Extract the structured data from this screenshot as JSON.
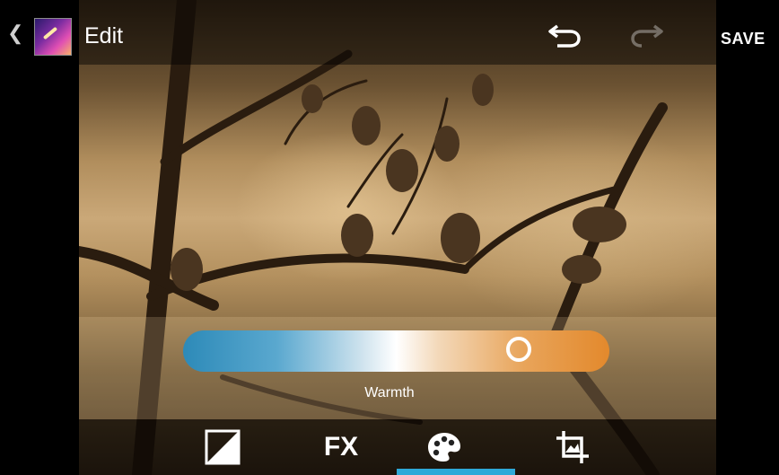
{
  "header": {
    "title": "Edit",
    "save_label": "SAVE",
    "icons": {
      "back": "chevron-left-icon",
      "app": "gallery-app-icon",
      "undo": "undo-icon",
      "redo": "redo-icon"
    }
  },
  "adjustment": {
    "label": "Warmth",
    "value_fraction": 0.79,
    "gradient_colors": [
      "#2d8ab8",
      "#ffffff",
      "#e3892c"
    ]
  },
  "toolbar": {
    "tools": [
      {
        "name": "exposure",
        "icon": "exposure-icon"
      },
      {
        "name": "effects",
        "label": "FX"
      },
      {
        "name": "colors",
        "icon": "palette-icon",
        "selected": true
      },
      {
        "name": "crop",
        "icon": "crop-icon"
      }
    ],
    "selected_color": "#2ea9d8"
  }
}
